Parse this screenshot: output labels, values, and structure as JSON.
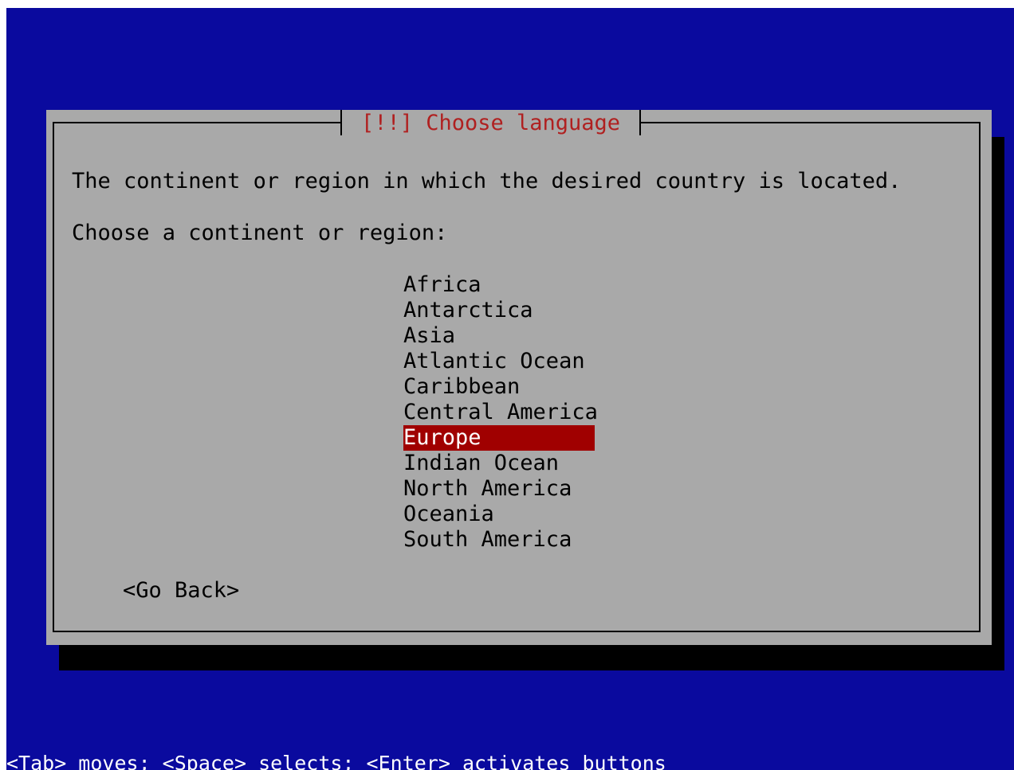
{
  "dialog": {
    "title": "[!!] Choose language",
    "description": "The continent or region in which the desired country is located.",
    "prompt": "Choose a continent or region:",
    "regions": [
      "Africa",
      "Antarctica",
      "Asia",
      "Atlantic Ocean",
      "Caribbean",
      "Central America",
      "Europe",
      "Indian Ocean",
      "North America",
      "Oceania",
      "South America"
    ],
    "selected_region": "Europe",
    "go_back_label": "<Go Back>"
  },
  "status_bar": {
    "text": "<Tab> moves; <Space> selects; <Enter> activates buttons"
  },
  "colors": {
    "screen_background": "#0a0a9e",
    "dialog_background": "#a9a9a9",
    "title_text": "#b02020",
    "selection_background": "#a00000",
    "selection_text": "#ffffff",
    "status_text": "#ffffff"
  }
}
